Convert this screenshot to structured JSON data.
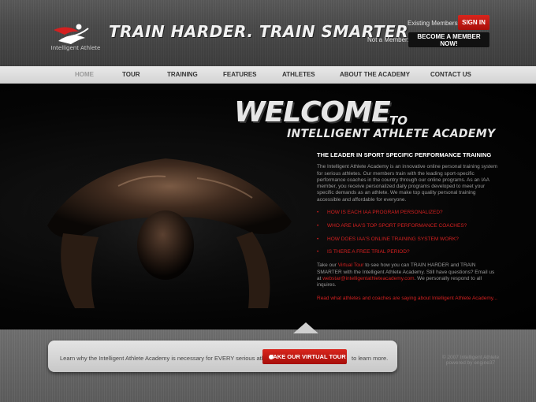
{
  "header": {
    "tagline": "TRAIN HARDER. TRAIN SMARTER.",
    "logo_text": "Intelligent Athlete",
    "existing_members_label": "Existing Members:",
    "signin_label": "SIGN IN",
    "not_member_label": "Not a Member:",
    "become_member_label": "BECOME A MEMBER NOW!"
  },
  "nav": {
    "items": [
      "HOME",
      "TOUR",
      "TRAINING",
      "FEATURES",
      "ATHLETES",
      "ABOUT THE ACADEMY",
      "CONTACT US"
    ],
    "active": "HOME"
  },
  "hero": {
    "welcome": "WELCOME",
    "to": "TO",
    "academy": "INTELLIGENT ATHLETE ACADEMY"
  },
  "content": {
    "heading": "THE LEADER IN SPORT SPECIFIC PERFORMANCE TRAINING",
    "intro": "The Intelligent Athlete Academy is an innovative online personal training system for serious athletes.  Our members train with the leading sport-specific performance coaches in the country through our online programs.  As an IAA member, you receive personalized daily programs developed to meet your specific demands as an athlete.  We make top quality personal training accessible and affordable for everyone.",
    "faq": [
      "HOW IS EACH IAA PROGRAM PERSONALIZED?",
      "WHO ARE IAA'S TOP SPORT PERFORMANCE COACHES?",
      "HOW DOES IAA'S ONLINE TRAINING SYSTEM WORK?",
      "IS THERE A FREE TRIAL PERIOD?"
    ],
    "tour_pre": "Take our ",
    "tour_link": "Virtual Tour",
    "tour_post": " to see how you can TRAIN HARDER and TRAIN SMARTER with the Intelligent Athlete Academy.  Still have questions?  Email us at ",
    "email": "webstar@intelligentathleteacademy.com",
    "email_post": ". We personally respond to all inquires.",
    "read_more": "Read what athletes and coaches are saying about Intelligent Athlete Academy..."
  },
  "footer": {
    "tour_text_before": "Learn why the Intelligent Athlete Academy is necessary for EVERY serious athlete.",
    "tour_button": "TAKE OUR VIRTUAL TOUR",
    "tour_text_after": "to learn more.",
    "copyright_line1": "© 2007 Intelligent Athlete",
    "copyright_line2": "powered by engine37"
  },
  "colors": {
    "accent_red": "#d42020",
    "header_gray": "#4a4a4a",
    "nav_bg": "#dcdcdc",
    "main_bg": "#000000"
  }
}
